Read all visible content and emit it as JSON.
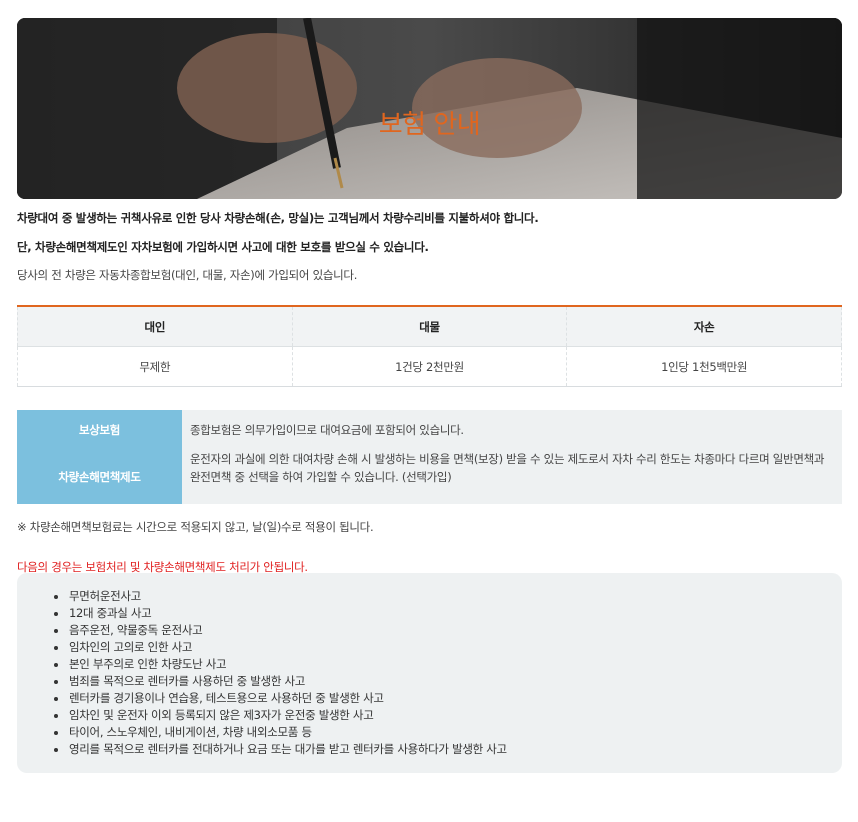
{
  "banner": {
    "title": "보험 안내"
  },
  "intro": {
    "line1": "차량대여 중 발생하는 귀책사유로 인한 당사 차량손해(손, 망실)는 고객님께서 차량수리비를 지불하셔야 합니다.",
    "line2": "단, 차량손해면책제도인 자차보험에 가입하시면 사고에 대한 보호를 받으실 수 있습니다.",
    "line3": "당사의 전 차량은 자동차종합보험(대인, 대물, 자손)에 가입되어 있습니다."
  },
  "coverage": {
    "headers": [
      "대인",
      "대물",
      "자손"
    ],
    "values": [
      "무제한",
      "1건당 2천만원",
      "1인당 1천5백만원"
    ]
  },
  "insurance_info": {
    "rows": [
      {
        "label": "보상보험",
        "desc": "종합보험은 의무가입이므로 대여요금에 포함되어 있습니다."
      },
      {
        "label": "차량손해면책제도",
        "desc": "운전자의 과실에 의한 대여차량 손해 시 발생하는 비용을 면책(보장) 받을 수 있는 제도로서 자차 수리 한도는 차종마다 다르며 일반면책과 완전면책 중 선택을 하여 가입할 수 있습니다. (선택가입)"
      }
    ]
  },
  "note": "※ 차량손해면책보험료는 시간으로 적용되지 않고, 날(일)수로 적용이 됩니다.",
  "warning": "다음의 경우는 보험처리 및 차량손해면책제도 처리가 안됩니다.",
  "exclusions": [
    "무면허운전사고",
    "12대 중과실 사고",
    "음주운전, 약물중독 운전사고",
    "임차인의 고의로 인한 사고",
    "본인 부주의로 인한 차량도난 사고",
    "범죄를 목적으로 렌터카를 사용하던 중 발생한 사고",
    "렌터카를 경기용이나 연습용, 테스트용으로 사용하던 중 발생한 사고",
    "임차인 및 운전자 이외 등록되지 않은 제3자가 운전중 발생한 사고",
    "타이어, 스노우체인, 내비게이션, 차량 내외소모품 등",
    "영리를 목적으로 렌터카를 전대하거나 요금 또는 대가를 받고 렌터카를 사용하다가 발생한 사고"
  ],
  "colors": {
    "accent": "#e0661f",
    "label_bg": "#7cc0de",
    "panel_bg": "#eef1f2",
    "warning": "#e02020"
  }
}
